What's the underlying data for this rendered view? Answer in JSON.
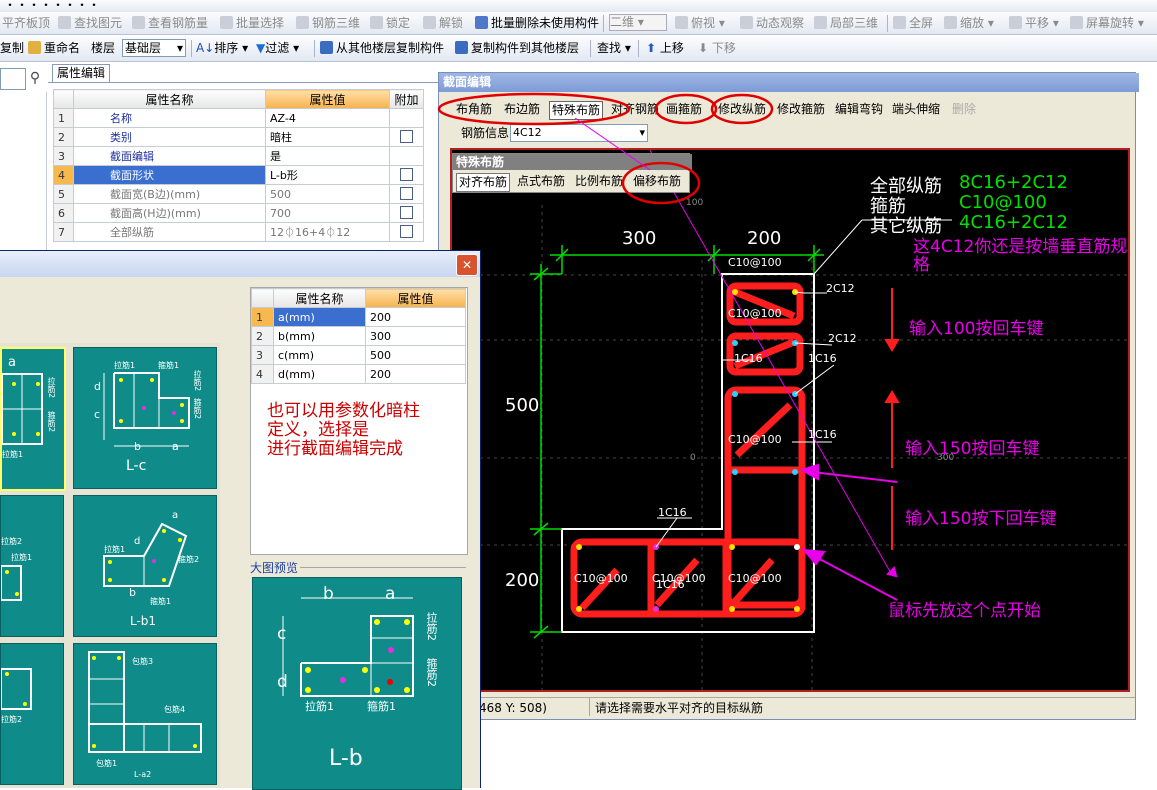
{
  "toolbar1": {
    "items": [
      "平齐板顶",
      "查找图元",
      "查看钢筋量",
      "批量选择",
      "钢筋三维",
      "锁定",
      "解锁",
      "批量删除未使用构件",
      "二维",
      "俯视",
      "动态观察",
      "局部三维",
      "全屏",
      "缩放",
      "平移",
      "屏幕旋转"
    ]
  },
  "toolbar2": {
    "copy": "复制",
    "rename": "重命名",
    "floor_label": "楼层",
    "floor_value": "基础层",
    "sort": "排序",
    "filter": "过滤",
    "copy_from": "从其他楼层复制构件",
    "copy_to": "复制构件到其他楼层",
    "find": "查找",
    "move_up": "上移",
    "move_down": "下移"
  },
  "props_tab": "属性编辑",
  "props": {
    "headers": [
      "属性名称",
      "属性值",
      "附加"
    ],
    "rows": [
      {
        "n": "1",
        "name": "名称",
        "value": "AZ-4",
        "cb": false
      },
      {
        "n": "2",
        "name": "类别",
        "value": "暗柱",
        "cb": true
      },
      {
        "n": "3",
        "name": "截面编辑",
        "value": "是",
        "cb": false
      },
      {
        "n": "4",
        "name": "截面形状",
        "value": "L-b形",
        "cb": true
      },
      {
        "n": "5",
        "name": "截面宽(B边)(mm)",
        "value": "500",
        "cb": true
      },
      {
        "n": "6",
        "name": "截面高(H边)(mm)",
        "value": "700",
        "cb": true
      },
      {
        "n": "7",
        "name": "全部纵筋",
        "value": "12⏀16+4⏀12",
        "cb": true
      }
    ]
  },
  "shape_dialog": {
    "param_headers": [
      "属性名称",
      "属性值"
    ],
    "params": [
      {
        "n": "1",
        "name": "a(mm)",
        "value": "200"
      },
      {
        "n": "2",
        "name": "b(mm)",
        "value": "300"
      },
      {
        "n": "3",
        "name": "c(mm)",
        "value": "500"
      },
      {
        "n": "4",
        "name": "d(mm)",
        "value": "200"
      }
    ],
    "note": "也可以用参数化暗柱\n定义，选择是\n进行截面编辑完成",
    "preview_label": "大图预览",
    "preview": {
      "b": "b",
      "a": "a",
      "c": "c",
      "d": "d",
      "la1": "拉筋1",
      "gu1": "箍筋1",
      "la2": "拉筋2",
      "gu2": "箍筋2",
      "title": "L-b"
    },
    "tiles": {
      "t1": {
        "la1": "拉筋1",
        "gu1": "箍筋1",
        "la2": "拉筋2",
        "gu2": "箍筋2",
        "title": "L-c",
        "b": "b",
        "a": "a",
        "c": "c",
        "d": "d"
      },
      "t2": {
        "gu2": "箍筋2",
        "gu1": "箍筋1",
        "la1": "拉筋1",
        "title": "L-b1",
        "b": "b",
        "a": "a",
        "d": "d"
      },
      "t3": {
        "b3": "包筋3",
        "b4": "包筋4",
        "b1": "包筋1",
        "t": "L-a2"
      },
      "left": {
        "a": "a",
        "l1": "拉筋2",
        "l2": "箍筋2",
        "l3": "拉筋1",
        "l4": "拉筋2",
        "l5": "拉筋1",
        "l6": "拉筋2"
      }
    }
  },
  "section_dialog": {
    "title": "截面编辑",
    "buttons": [
      "布角筋",
      "布边筋",
      "特殊布筋",
      "对齐钢筋",
      "画箍筋",
      "修改纵筋",
      "修改箍筋",
      "编辑弯钩",
      "端头伸缩",
      "删除"
    ],
    "rebar_info_label": "钢筋信息",
    "rebar_info_value": "4C12",
    "special_title": "特殊布筋",
    "special_buttons": [
      "对齐布筋",
      "点式布筋",
      "比例布筋",
      "偏移布筋"
    ],
    "status_coords": "468 Y: 508)",
    "status_msg": "请选择需要水平对齐的目标纵筋"
  },
  "cad": {
    "legend": [
      {
        "label": "全部纵筋",
        "value": "8C16+2C12"
      },
      {
        "label": "箍筋",
        "value": "C10@100"
      },
      {
        "label": "其它纵筋",
        "value": "4C16+2C12"
      }
    ],
    "dims": {
      "d300": "300",
      "d200_top": "200",
      "d500": "500",
      "d200_left": "200"
    },
    "labels": {
      "c10_1": "C10@100",
      "c10_2": "C10@100",
      "c10_3": "C10@100",
      "c10_4": "C10@100",
      "c10_5": "C10@100",
      "c10_6": "C10@100",
      "c2c12a": "2C12",
      "c2c12b": "2C12",
      "c1c16a": "1C16",
      "c1c16b": "1C16",
      "c1c16c": "1C16",
      "c1c16d": "1C16",
      "c1c16e": "1C16",
      "g100": "100",
      "g0": "0",
      "g300": "300"
    },
    "ann1": "这4C12你还是按墙垂直筋规格",
    "ann2": "输入100按回车键",
    "ann3": "输入150按回车键",
    "ann4": "输入150按下回车键",
    "ann5": "鼠标先放这个点开始"
  },
  "colors": {
    "cad_bg": "#000000",
    "rebar": "#ff1e1e",
    "dim": "#00e000",
    "annotation": "#e800e8",
    "teal": "#0f8b89",
    "note_red": "#cc0000"
  }
}
